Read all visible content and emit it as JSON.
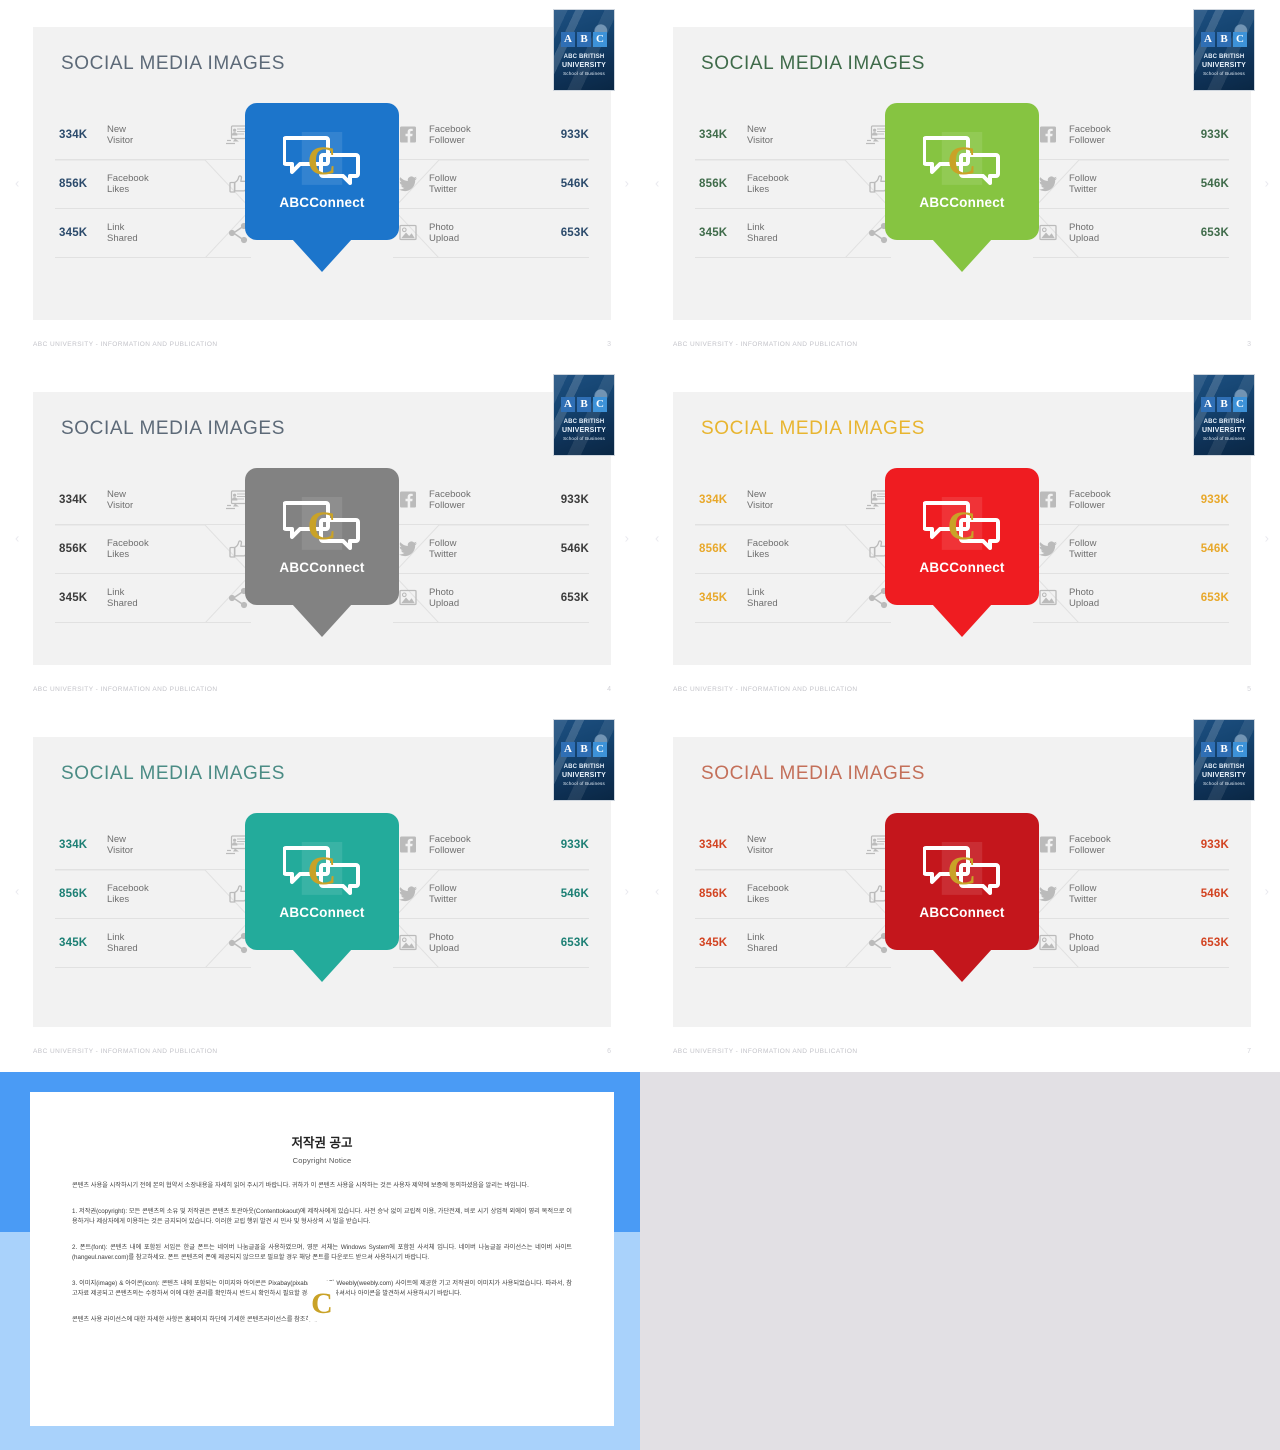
{
  "deck": {
    "logo": {
      "letters": [
        "A",
        "B",
        "C"
      ],
      "line1": "ABC BRITISH",
      "line2": "UNIVERSITY",
      "line3": "School of Business"
    },
    "footer_text": "ABC UNIVERSITY - INFORMATION AND PUBLICATION",
    "nav": {
      "prev": "‹",
      "next": "›"
    },
    "title": "SOCIAL MEDIA IMAGES",
    "brand_name": "ABCConnect",
    "left_stats": [
      {
        "value": "334K",
        "label_line1": "New",
        "label_line2": "Visitor",
        "icon": "monitor-user-icon"
      },
      {
        "value": "856K",
        "label_line1": "Facebook",
        "label_line2": "Likes",
        "icon": "thumbs-up-icon"
      },
      {
        "value": "345K",
        "label_line1": "Link",
        "label_line2": "Shared",
        "icon": "share-nodes-icon"
      }
    ],
    "right_stats": [
      {
        "value": "933K",
        "label_line1": "Facebook",
        "label_line2": "Follower",
        "icon": "facebook-icon"
      },
      {
        "value": "546K",
        "label_line1": "Follow",
        "label_line2": "Twitter",
        "icon": "twitter-icon"
      },
      {
        "value": "653K",
        "label_line1": "Photo",
        "label_line2": "Upload",
        "icon": "photo-icon"
      }
    ]
  },
  "slides": [
    {
      "page": "3",
      "accent": "#1c75cb",
      "title_color": "#5d6a78",
      "num_color": "#2b4a6b"
    },
    {
      "page": "3",
      "accent": "#86c441",
      "title_color": "#3f6b4a",
      "num_color": "#3f6b4a"
    },
    {
      "page": "4",
      "accent": "#828282",
      "title_color": "#5d6a78",
      "num_color": "#3b3b3b"
    },
    {
      "page": "5",
      "accent": "#ef1c21",
      "title_color": "#e8b530",
      "num_color": "#e8a82a"
    },
    {
      "page": "6",
      "accent": "#23ab9b",
      "title_color": "#4b8c85",
      "num_color": "#1c7f74"
    },
    {
      "page": "7",
      "accent": "#c4161c",
      "title_color": "#c4705a",
      "num_color": "#d24321"
    }
  ],
  "copyright": {
    "title": "저작권 공고",
    "subtitle": "Copyright Notice",
    "intro": "콘텐츠 사용을 시작하시기 전에 본의 협약서 소장내용을 자세히 읽어 주시기 바랍니다. 귀하가 이 콘텐츠 사용을 시작하는 것은 사용자 제약에 보증에 동의하셨음을 알리는 바입니다.",
    "section1": "1. 저작권(copyright): 모든 콘텐츠의 소유 및 저작권은 콘텐츠 토관아웃(Contenttokaout)에 제작사에게 있습니다. 사전 승낙 없이 교립적 이용, 가단전제, 비로 시기 상업적 외에이 영리 목적으로 이용하거나 제삼자에게 이용하는 것은 금지되어 있습니다. 이러한 교립 행위 발견 시 민사 및 형사상의 시 벌을 받습니다.",
    "section2": "2. 폰트(font): 콘텐츠 내에 포함된 서입은 한글 폰트는 네이버 나눔글꼴을 사용하였으며, 영문 서체는 Windows System에 포함된 사서체 입니다. 네이버 나눔글꼴 라이선스는 네이버 사이트(hangeul.naver.com)를 참고하세요. 폰트 콘텐츠의 폰에 제공되지 않으므로 필요할 경우 해당 폰트를 다운로드 받으셔 사용하시기 바랍니다.",
    "section3": "3. 이미지(image) & 아이콘(icon): 콘텐츠 내에 포함되는 이미지와 아이콘은 Pixabay(pixabay.com)와 Weebly(weebly.com) 사이트에 제공한 기고 저작권이 이미지가 사용되었습니다. 따라서, 참고자료 제공되고 콘텐츠의는 수정하셔 이에 대한 권리를 확인하시 반드시 확인하시 필요할 경우 여기를 하셔서나 아이콘을 발견하셔 사용하시기 바랍니다.",
    "outro": "콘텐츠 사용 라이선스에 대한 자세한 사항은 홈페이지 하단에 기세한 콘텐츠라이선스를 참조하세요."
  }
}
